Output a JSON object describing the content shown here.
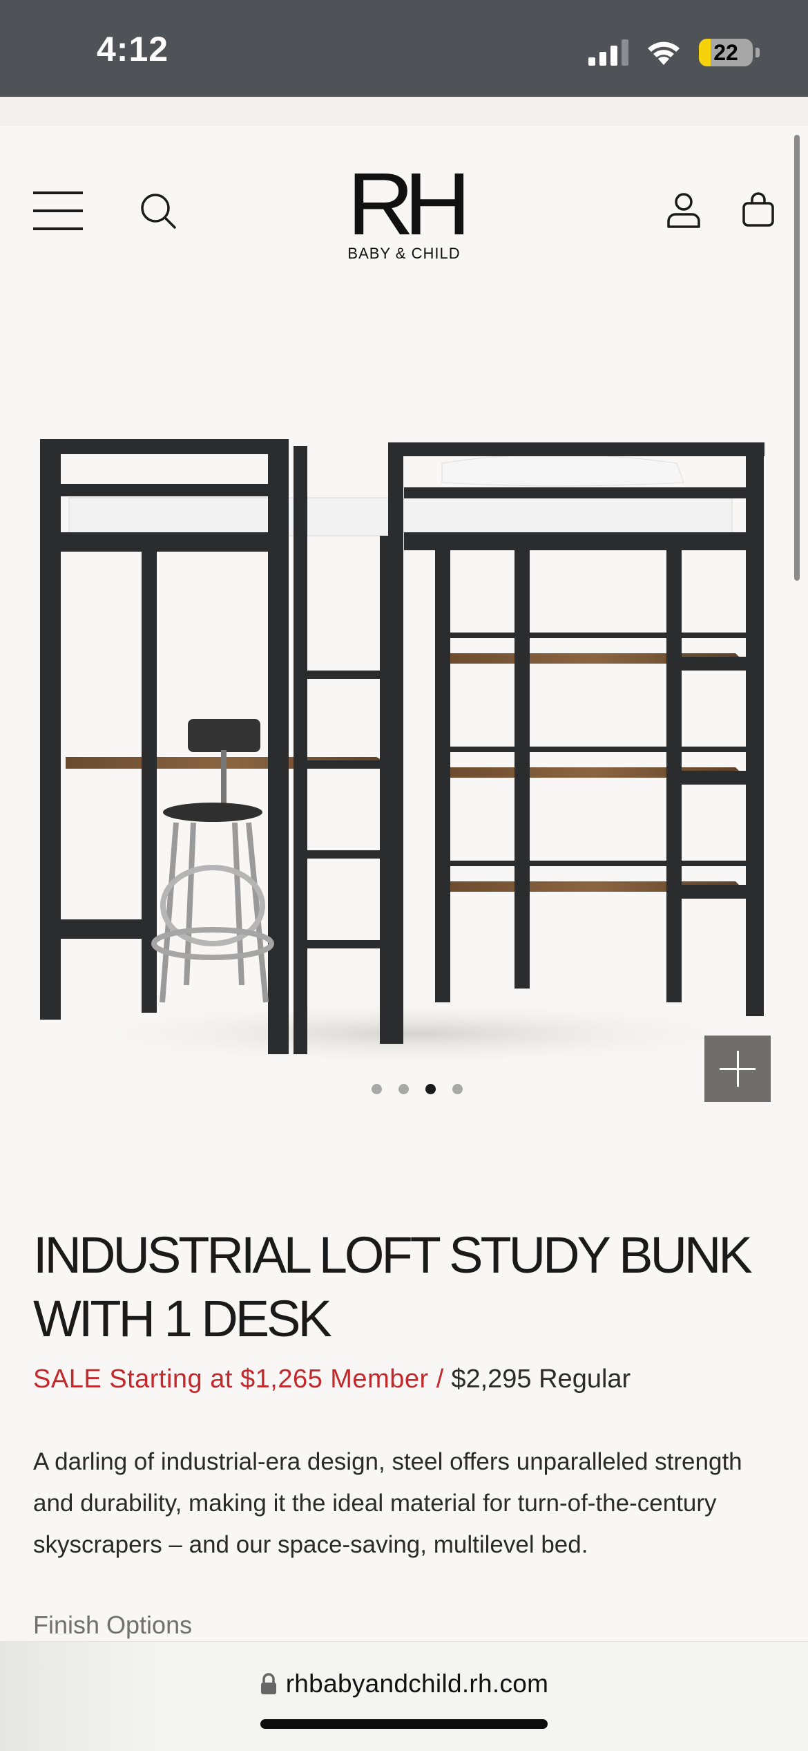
{
  "status_bar": {
    "time": "4:12",
    "battery_level": "22",
    "battery_fraction": 0.22,
    "icons": [
      "cellular-signal-icon",
      "wifi-icon",
      "battery-icon"
    ]
  },
  "header": {
    "logo_mark": "RH",
    "logo_subtitle": "BABY & CHILD",
    "icons": [
      "menu-icon",
      "search-icon",
      "account-icon",
      "shopping-bag-icon"
    ]
  },
  "gallery": {
    "image_subject": "loft bed with desk, stool and shelves",
    "dot_count": 4,
    "active_index": 2,
    "zoom_icon": "plus-icon"
  },
  "product": {
    "title": "INDUSTRIAL LOFT STUDY BUNK WITH 1 DESK",
    "price_sale": "SALE Starting at $1,265 Member /",
    "price_regular": "$2,295 Regular",
    "description": "A darling of industrial-era design, steel offers unparalleled strength and durability, making it the ideal material for turn-of-the-century skyscrapers – and our space-saving, multilevel bed.",
    "finish_options_label": "Finish Options"
  },
  "browser": {
    "url": "rhbabyandchild.rh.com"
  },
  "colors": {
    "status_bar_bg": "#4f5256",
    "page_bg": "#f8f7f5",
    "sale_red": "#c2282c",
    "zoom_button_bg": "#6f6e6a",
    "battery_yellow": "#f5d20b"
  }
}
